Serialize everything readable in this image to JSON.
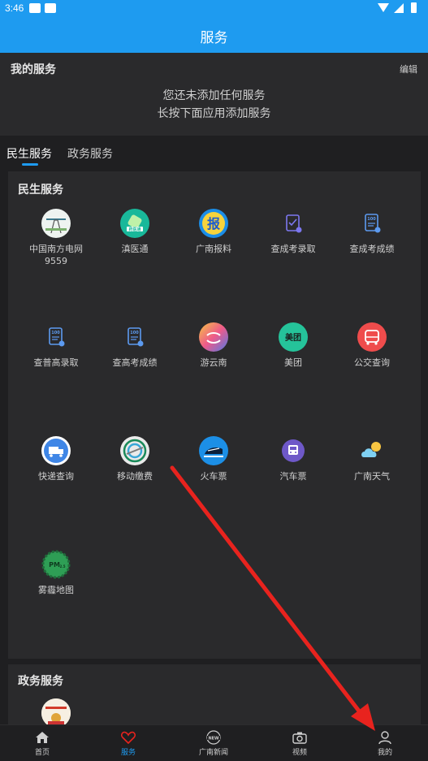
{
  "status_bar": {
    "time": "3:46",
    "notif1": "tell",
    "notif2": "INFO"
  },
  "app_bar": {
    "title": "服务"
  },
  "my_services": {
    "title": "我的服务",
    "edit_label": "编辑",
    "empty_line1": "您还未添加任何服务",
    "empty_line2": "长按下面应用添加服务"
  },
  "tabs": [
    {
      "label": "民生服务",
      "active": true
    },
    {
      "label": "政务服务",
      "active": false
    }
  ],
  "livelihood": {
    "title": "民生服务",
    "items": [
      {
        "label": "中国南方电网\n9559",
        "icon": "power-grid-icon",
        "color": "#eef3f0"
      },
      {
        "label": "滇医通",
        "icon": "medical-app-icon",
        "color": "#19b89a"
      },
      {
        "label": "广南报料",
        "icon": "report-icon",
        "color": "#1b8ee8"
      },
      {
        "label": "查成考录取",
        "icon": "admission-clipboard-icon",
        "color": "#5c5ad8"
      },
      {
        "label": "查成考成绩",
        "icon": "score-card-icon",
        "color": "#3b7be0"
      },
      {
        "label": "查普高录取",
        "icon": "score-card-icon",
        "color": "#3b7be0"
      },
      {
        "label": "查高考成绩",
        "icon": "score-card-icon",
        "color": "#3b7be0"
      },
      {
        "label": "游云南",
        "icon": "travel-yunnan-icon",
        "color": "#f2a339"
      },
      {
        "label": "美团",
        "icon": "meituan-icon",
        "color": "#25c39a"
      },
      {
        "label": "公交查询",
        "icon": "bus-icon",
        "color": "#ef4c4c"
      },
      {
        "label": "快递查询",
        "icon": "delivery-truck-icon",
        "color": "#ffffff"
      },
      {
        "label": "移动缴费",
        "icon": "china-mobile-icon",
        "color": "#eaeaea"
      },
      {
        "label": "火车票",
        "icon": "train-icon",
        "color": "#1c8fe6"
      },
      {
        "label": "汽车票",
        "icon": "coach-bus-icon",
        "color": "#6e58c8"
      },
      {
        "label": "广南天气",
        "icon": "weather-icon",
        "color": "#2a2a2c"
      },
      {
        "label": "雾霾地图",
        "icon": "pm25-icon",
        "color": "#2e9e55"
      }
    ]
  },
  "government": {
    "title": "政务服务"
  },
  "bottom_nav": [
    {
      "label": "首页",
      "icon": "home-icon",
      "active": false
    },
    {
      "label": "服务",
      "icon": "heart-icon",
      "active": true
    },
    {
      "label": "广南新闻",
      "icon": "news-icon",
      "active": false
    },
    {
      "label": "视频",
      "icon": "camera-icon",
      "active": false
    },
    {
      "label": "我的",
      "icon": "profile-icon",
      "active": false
    }
  ],
  "colors": {
    "brand": "#1e9bf0",
    "background": "#1f1f21",
    "card": "#2a2a2c",
    "annotation": "#e8231e"
  }
}
